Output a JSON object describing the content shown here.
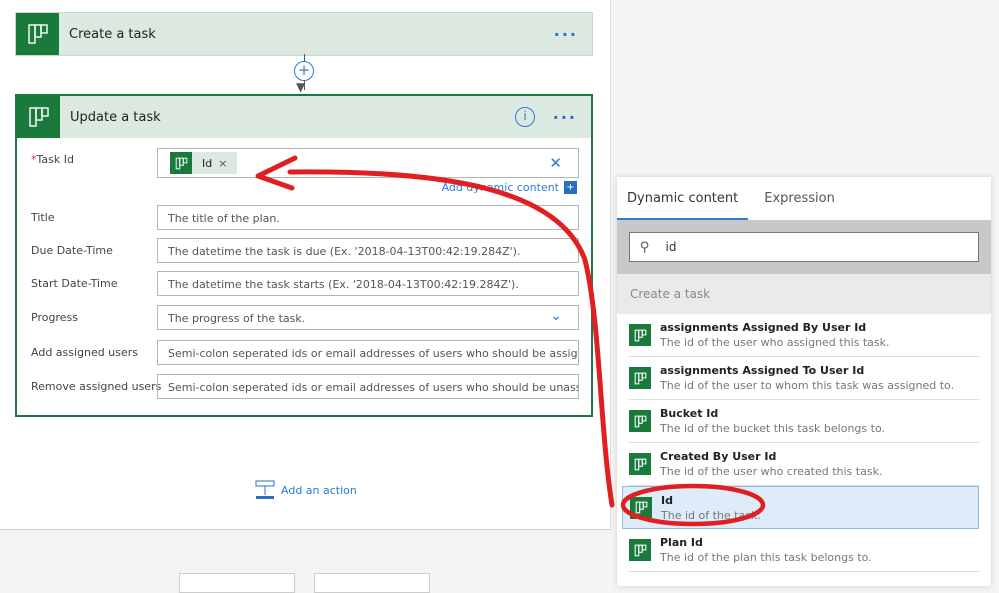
{
  "flow": {
    "create_card": {
      "title": "Create a task"
    },
    "update_card": {
      "title": "Update a task",
      "task_id": {
        "label": "Task Id",
        "required": "*",
        "token": "Id",
        "token_remove": "×",
        "clear": "✕",
        "add_dynamic": "Add dynamic content"
      },
      "fields": [
        {
          "label": "Title",
          "placeholder": "The title of the plan."
        },
        {
          "label": "Due Date-Time",
          "placeholder": "The datetime the task is due (Ex. '2018-04-13T00:42:19.284Z')."
        },
        {
          "label": "Start Date-Time",
          "placeholder": "The datetime the task starts (Ex. '2018-04-13T00:42:19.284Z')."
        },
        {
          "label": "Progress",
          "placeholder": "The progress of the task."
        },
        {
          "label": "Add assigned users",
          "placeholder": "Semi-colon seperated ids or email addresses of users who should be assigned to the task."
        },
        {
          "label": "Remove assigned users",
          "placeholder": "Semi-colon seperated ids or email addresses of users who should be unassigned from the task."
        }
      ]
    },
    "add_action": "Add an action"
  },
  "panel": {
    "tabs": [
      "Dynamic content",
      "Expression"
    ],
    "active_tab": "Dynamic content",
    "search_value": "id",
    "group": "Create a task",
    "items": [
      {
        "title": "assignments Assigned By User Id",
        "desc": "The id of the user who assigned this task."
      },
      {
        "title": "assignments Assigned To User Id",
        "desc": "The id of the user to whom this task was assigned to."
      },
      {
        "title": "Bucket Id",
        "desc": "The id of the bucket this task belongs to."
      },
      {
        "title": "Created By User Id",
        "desc": "The id of the user who created this task."
      },
      {
        "title": "Id",
        "desc": "The id of the task.",
        "selected": true
      },
      {
        "title": "Plan Id",
        "desc": "The id of the plan this task belongs to."
      }
    ]
  },
  "colors": {
    "brand": "#1a7a3c",
    "accent": "#2b7cd3",
    "annotation": "#e02020"
  }
}
